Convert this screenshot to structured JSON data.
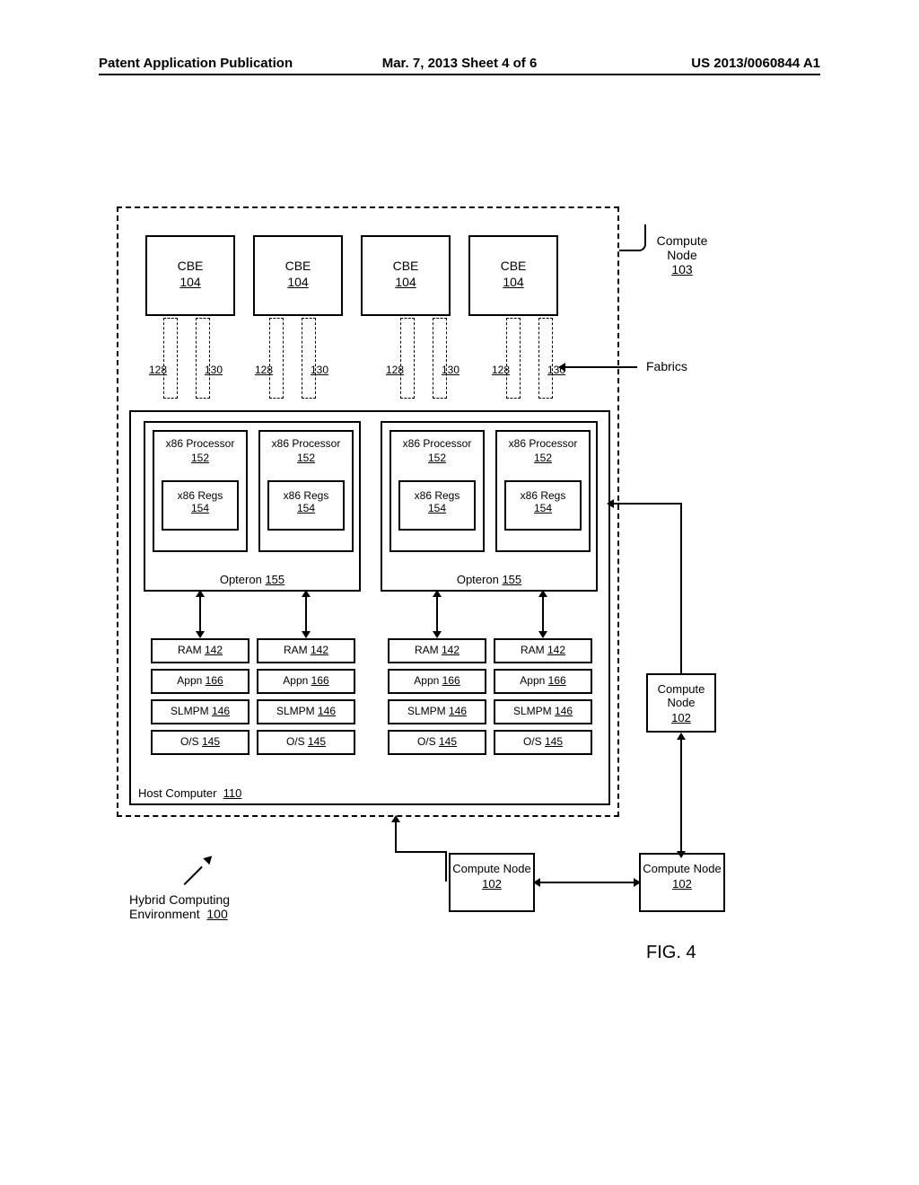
{
  "header": {
    "left": "Patent Application Publication",
    "mid": "Mar. 7, 2013  Sheet 4 of 6",
    "right": "US 2013/0060844 A1"
  },
  "labels": {
    "compute_node_103": "Compute Node",
    "ref_103": "103",
    "fabrics": "Fabrics",
    "compute_node_102": "Compute Node",
    "ref_102": "102",
    "host_computer": "Host Computer",
    "ref_110": "110",
    "hybrid_env": "Hybrid Computing",
    "hybrid_env2": "Environment",
    "ref_100": "100",
    "fig": "FIG. 4"
  },
  "cbe": {
    "name": "CBE",
    "ref": "104"
  },
  "fabric_a": "128",
  "fabric_b": "130",
  "proc": {
    "name": "x86 Processor",
    "ref": "152"
  },
  "regs": {
    "name": "x86 Regs",
    "ref": "154"
  },
  "opteron": {
    "name": "Opteron",
    "ref": "155"
  },
  "mem": [
    {
      "name": "RAM",
      "ref": "142"
    },
    {
      "name": "Appn",
      "ref": "166"
    },
    {
      "name": "SLMPM",
      "ref": "146"
    },
    {
      "name": "O/S",
      "ref": "145"
    }
  ],
  "cn_box": {
    "name": "Compute Node",
    "ref": "102"
  }
}
